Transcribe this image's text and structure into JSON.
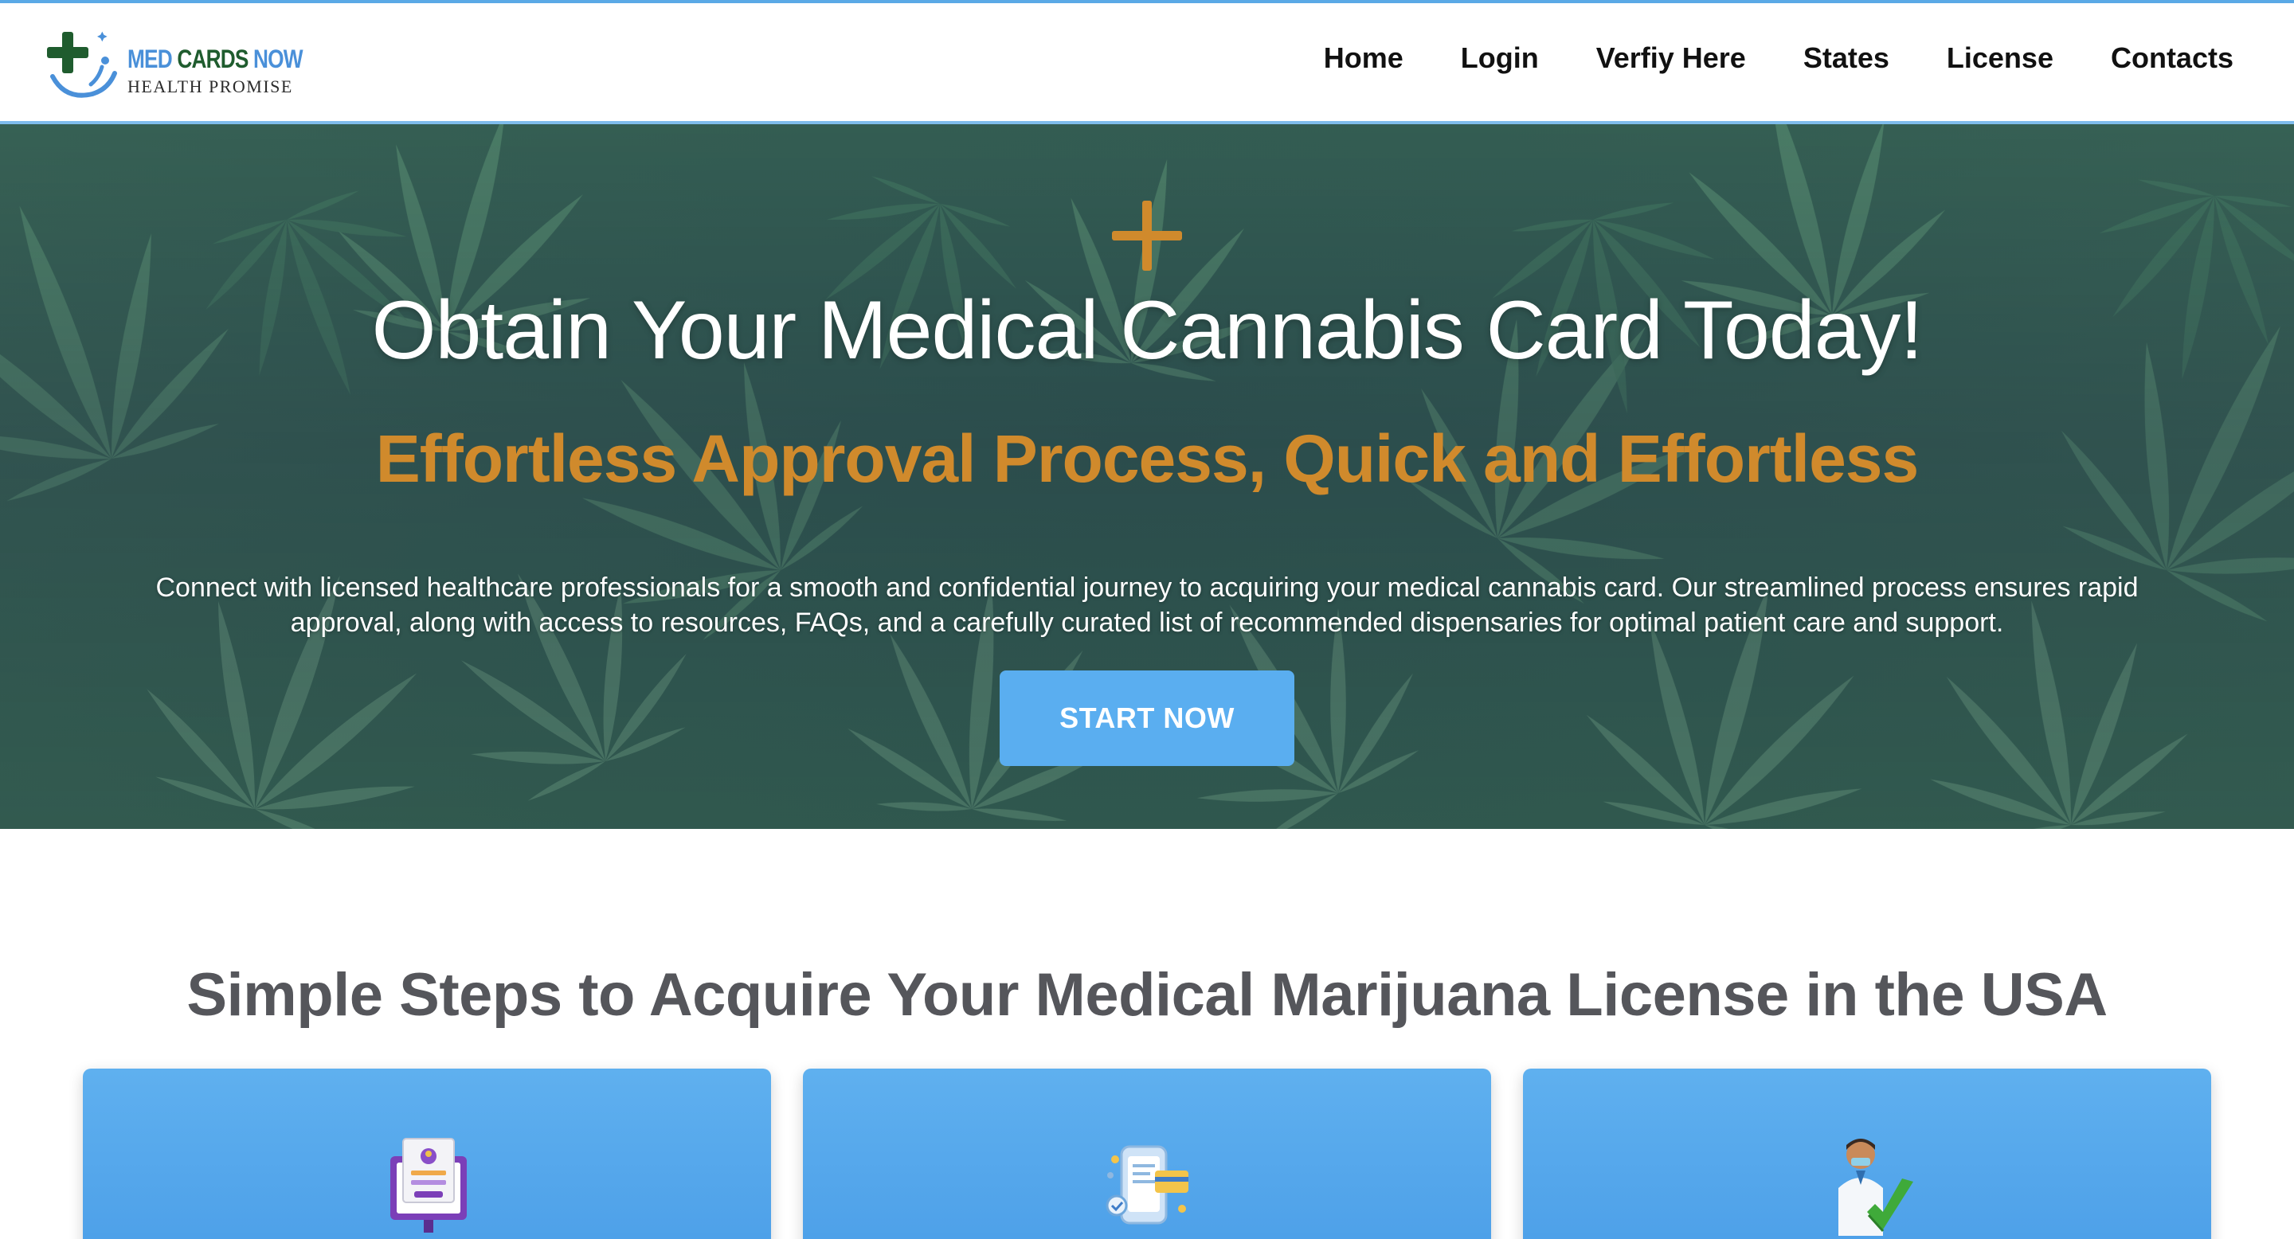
{
  "brand": {
    "name_med": "MED",
    "name_cards": "CARDS",
    "name_now": "NOW",
    "tagline": "HEALTH PROMISE",
    "colors": {
      "blue": "#4a90d9",
      "green": "#1f5c2e"
    }
  },
  "nav": {
    "items": [
      {
        "label": "Home"
      },
      {
        "label": "Login"
      },
      {
        "label": "Verfiy Here"
      },
      {
        "label": "States"
      },
      {
        "label": "License"
      },
      {
        "label": "Contacts"
      }
    ]
  },
  "hero": {
    "title": "Obtain Your Medical Cannabis Card Today!",
    "subtitle": "Effortless Approval Process, Quick and Effortless",
    "description": "Connect with licensed healthcare professionals for a smooth and confidential journey to acquiring your medical cannabis card. Our streamlined process ensures rapid approval, along with access to resources, FAQs, and a carefully curated list of recommended dispensaries for optimal patient care and support.",
    "button_label": "START NOW",
    "accent_color": "#d08a2c",
    "button_color": "#5aaef0",
    "icon": "plus-icon"
  },
  "steps": {
    "title": "Simple Steps to Acquire Your Medical Marijuana License in the USA",
    "cards": [
      {
        "icon": "online-form-icon"
      },
      {
        "icon": "payment-phone-icon"
      },
      {
        "icon": "doctor-approval-icon"
      }
    ]
  }
}
